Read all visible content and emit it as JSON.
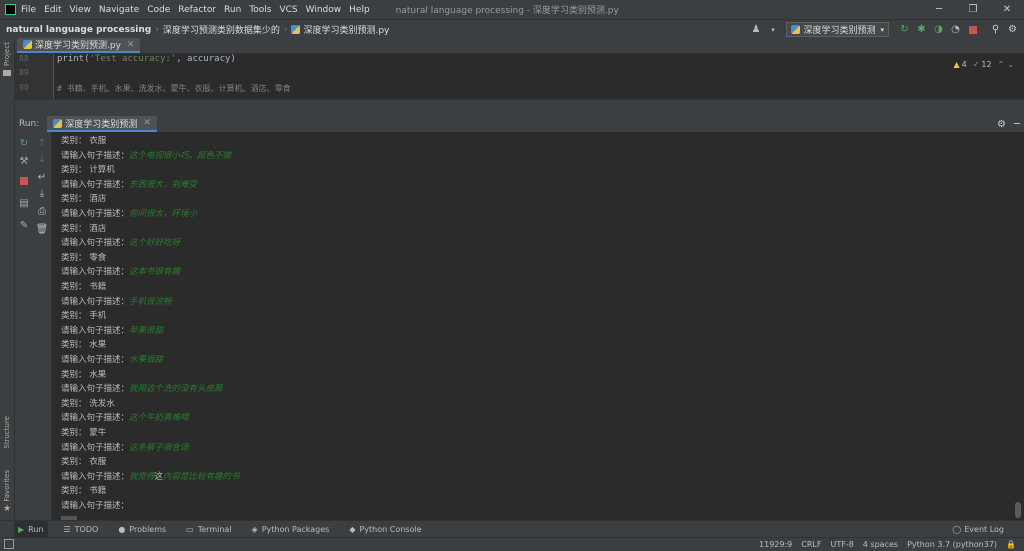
{
  "menubar": {
    "items": [
      "File",
      "Edit",
      "View",
      "Navigate",
      "Code",
      "Refactor",
      "Run",
      "Tools",
      "VCS",
      "Window",
      "Help"
    ],
    "window_title": "natural language processing - 深度学习类别预测.py",
    "minimize": "─",
    "maximize": "❐",
    "close": "✕"
  },
  "navbar": {
    "project": "natural language processing",
    "folder": "深度学习预测类别数据集少的",
    "file": "深度学习类别预测.py",
    "run_config": "深度学习类别预测"
  },
  "left_strip": {
    "project_label": "Project",
    "structure_label": "Structure",
    "favorites_label": "Favorites"
  },
  "editor_tab": {
    "label": "深度学习类别预测.py"
  },
  "editor": {
    "lines": [
      {
        "num": "88",
        "code_func": "print(",
        "code_str": "'Test accuracy:'",
        "code_rest": ", accuracy)"
      },
      {
        "num": "89"
      },
      {
        "num": "90",
        "comment": "# 书籍、手机、水果、洗发水、蒙牛、衣服、计算机、酒店、零食"
      }
    ],
    "warnings": "4",
    "weak_warnings": "12"
  },
  "run_panel": {
    "label": "Run:",
    "tab": "深度学习类别预测"
  },
  "console": {
    "lines": [
      {
        "prompt": "类别：  衣服"
      },
      {
        "prompt": "请输入句子描述：",
        "input": "这个电视很小巧，颜色不错"
      },
      {
        "prompt": "类别：  计算机"
      },
      {
        "prompt": "请输入句子描述：",
        "input": "东西很大，别难受"
      },
      {
        "prompt": "类别：  酒店"
      },
      {
        "prompt": "请输入句子描述：",
        "input": "房间很大，环境小"
      },
      {
        "prompt": "类别：  酒店"
      },
      {
        "prompt": "请输入句子描述：",
        "input": "这个好好吃呀"
      },
      {
        "prompt": "类别：  零食"
      },
      {
        "prompt": "请输入句子描述：",
        "input": "这本书很有趣"
      },
      {
        "prompt": "类别：  书籍"
      },
      {
        "prompt": "请输入句子描述：",
        "input": "手机很流畅"
      },
      {
        "prompt": "类别：  手机"
      },
      {
        "prompt": "请输入句子描述：",
        "input": "苹果很甜"
      },
      {
        "prompt": "类别：  水果"
      },
      {
        "prompt": "请输入句子描述：",
        "input": "水果很甜"
      },
      {
        "prompt": "类别：  水果"
      },
      {
        "prompt": "请输入句子描述：",
        "input": "我用这个洗的没有头皮屑"
      },
      {
        "prompt": "类别：  洗发水"
      },
      {
        "prompt": "请输入句子描述：",
        "input": "这个牛奶真难喝"
      },
      {
        "prompt": "类别：  蒙牛"
      },
      {
        "prompt": "请输入句子描述：",
        "input": "这条裤子很合适"
      },
      {
        "prompt": "类别：  衣服"
      },
      {
        "prompt": "请输入句子描述：",
        "input": "我觉得",
        "input_plain": "这",
        "input_after": "内容是比较有趣的书"
      },
      {
        "prompt": "类别：  书籍"
      },
      {
        "prompt": "请输入句子描述："
      }
    ]
  },
  "bottom_tools": [
    {
      "label": "Run",
      "icon": "▶"
    },
    {
      "label": "TODO",
      "icon": "☰"
    },
    {
      "label": "Problems",
      "icon": "●"
    },
    {
      "label": "Terminal",
      "icon": "▭"
    },
    {
      "label": "Python Packages",
      "icon": "◈"
    },
    {
      "label": "Python Console",
      "icon": "◆"
    }
  ],
  "event_log": "Event Log",
  "status": {
    "position": "11929:9",
    "line_sep": "CRLF",
    "encoding": "UTF-8",
    "indent": "4 spaces",
    "interpreter": "Python 3.7 (python37)"
  }
}
